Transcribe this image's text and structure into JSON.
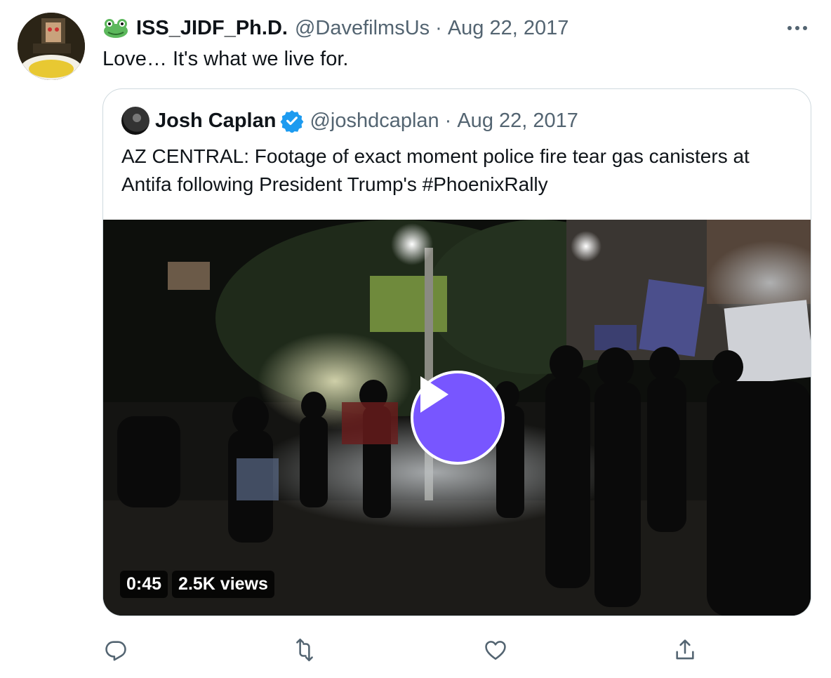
{
  "tweet": {
    "display_name": "ISS_JIDF_Ph.D.",
    "name_emoji_icon": "frog-icon",
    "handle": "@DavefilmsUs",
    "separator": "·",
    "date": "Aug 22, 2017",
    "text": "Love… It's what we live for."
  },
  "quoted_tweet": {
    "display_name": "Josh Caplan",
    "verified": true,
    "handle": "@joshdcaplan",
    "separator": "·",
    "date": "Aug 22, 2017",
    "text": "AZ CENTRAL: Footage of exact moment police fire tear gas canisters at Antifa following President Trump's #PhoenixRally",
    "video": {
      "duration": "0:45",
      "views": "2.5K views",
      "play_button_color": "#7856ff"
    }
  },
  "actions": [
    {
      "icon": "reply-icon"
    },
    {
      "icon": "retweet-icon"
    },
    {
      "icon": "like-icon"
    },
    {
      "icon": "share-icon"
    }
  ],
  "colors": {
    "text": "#0f1419",
    "secondary": "#536471",
    "border": "#cfd9de",
    "verified": "#1d9bf0"
  }
}
